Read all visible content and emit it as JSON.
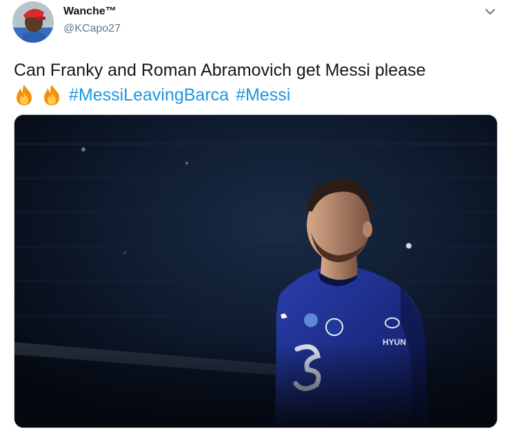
{
  "tweet": {
    "display_name": "Wanche™",
    "handle": "@KCapo27",
    "text": "Can Franky and Roman Abramovich get Messi please",
    "emoji": [
      "fire-emoji",
      "fire-emoji"
    ],
    "hashtags": [
      "#MessiLeavingBarca",
      "#Messi"
    ],
    "media": {
      "type": "photo",
      "shirt_text": "HYUN"
    }
  },
  "icons": {
    "menu": "chevron-down-icon"
  },
  "colors": {
    "hashtag": "#1b95e0",
    "handle": "#657786",
    "text": "#14171a",
    "photo_background": "#07101f",
    "jersey": "#1b2c8f"
  }
}
